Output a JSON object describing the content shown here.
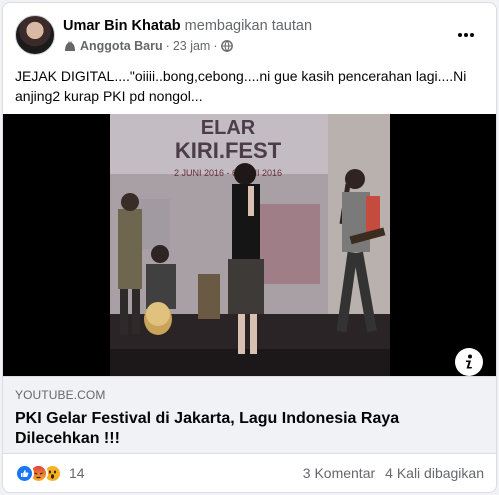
{
  "post": {
    "author": "Umar Bin Khatab",
    "action": "membagikan tautan",
    "badge_label": "Anggota Baru",
    "separator": "·",
    "time": "23 jam",
    "separator2": "·",
    "text": "JEJAK DIGITAL....\"oiiii..bong,cebong....ni gue kasih pencerahan lagi....Ni anjing2 kurap PKI pd nongol..."
  },
  "video": {
    "banner_line1": "ELAR",
    "banner_line2": "KIRI.FEST",
    "banner_line3": "2 JUNI 2016 - 6 JUNI 2016"
  },
  "link": {
    "domain": "YOUTUBE.COM",
    "title": "PKI Gelar Festival di Jakarta, Lagu Indonesia Raya Dilecehkan !!!"
  },
  "footer": {
    "reaction_count": "14",
    "comments": "3 Komentar",
    "shares": "4 Kali dibagikan"
  },
  "colors": {
    "like": "#1877f2",
    "angry": "#e9710f",
    "wow": "#f7b125"
  }
}
